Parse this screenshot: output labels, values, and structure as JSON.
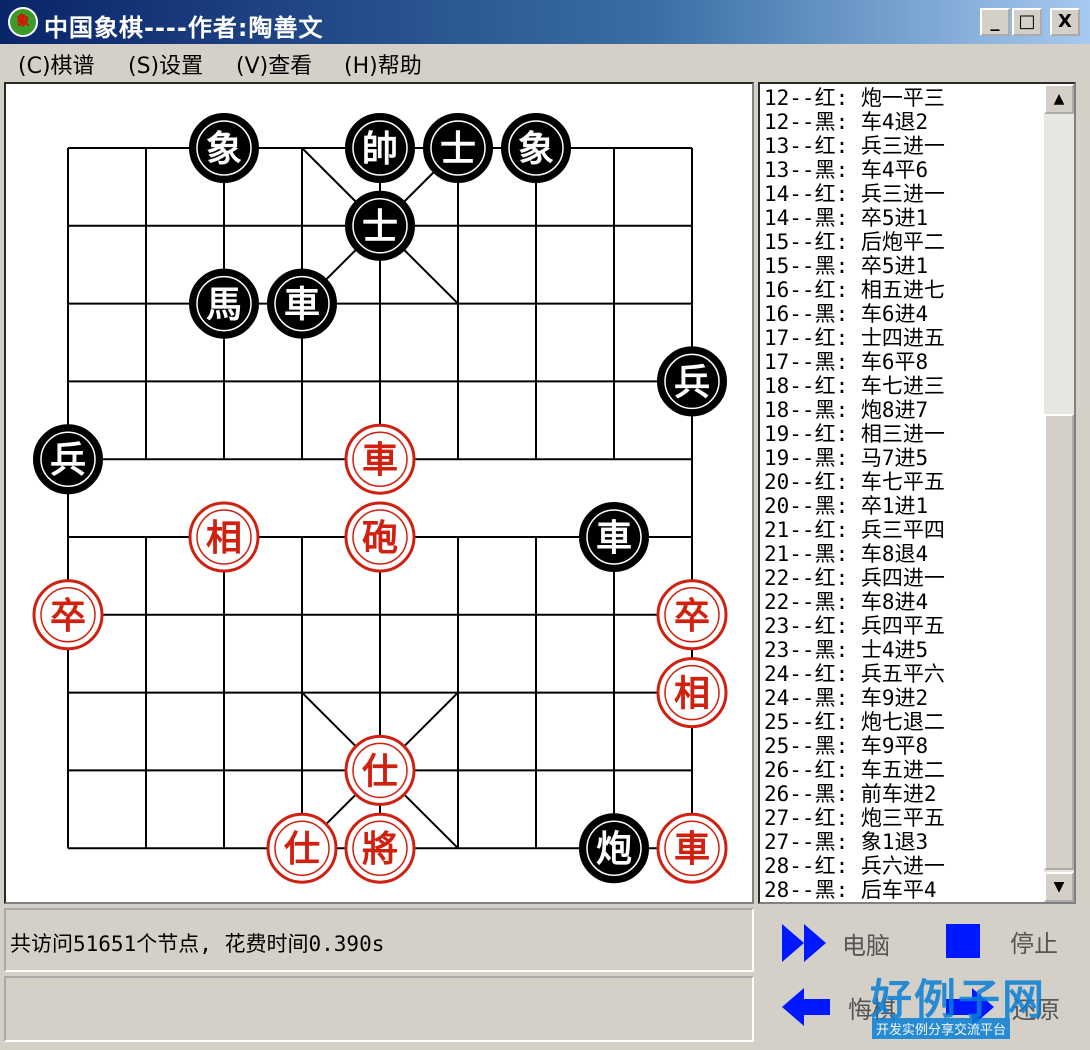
{
  "window": {
    "title": "中国象棋----作者:陶善文",
    "app_icon_text": "象",
    "controls": {
      "minimize": "_",
      "maximize": "□",
      "close": "X"
    }
  },
  "menu": [
    {
      "label": "(C)棋谱"
    },
    {
      "label": "(S)设置"
    },
    {
      "label": "(V)查看"
    },
    {
      "label": "(H)帮助"
    }
  ],
  "board": {
    "files": 9,
    "ranks": 10,
    "pieces": [
      {
        "color": "black",
        "char": "象",
        "file": 2,
        "rank": 0
      },
      {
        "color": "black",
        "char": "帥",
        "file": 4,
        "rank": 0
      },
      {
        "color": "black",
        "char": "士",
        "file": 5,
        "rank": 0
      },
      {
        "color": "black",
        "char": "象",
        "file": 6,
        "rank": 0
      },
      {
        "color": "black",
        "char": "士",
        "file": 4,
        "rank": 1
      },
      {
        "color": "black",
        "char": "馬",
        "file": 2,
        "rank": 2
      },
      {
        "color": "black",
        "char": "車",
        "file": 3,
        "rank": 2
      },
      {
        "color": "black",
        "char": "兵",
        "file": 8,
        "rank": 3
      },
      {
        "color": "black",
        "char": "兵",
        "file": 0,
        "rank": 4
      },
      {
        "color": "red",
        "char": "車",
        "file": 4,
        "rank": 4
      },
      {
        "color": "red",
        "char": "相",
        "file": 2,
        "rank": 5
      },
      {
        "color": "red",
        "char": "砲",
        "file": 4,
        "rank": 5
      },
      {
        "color": "black",
        "char": "車",
        "file": 7,
        "rank": 5
      },
      {
        "color": "red",
        "char": "卒",
        "file": 0,
        "rank": 6
      },
      {
        "color": "red",
        "char": "卒",
        "file": 8,
        "rank": 6
      },
      {
        "color": "red",
        "char": "相",
        "file": 8,
        "rank": 7
      },
      {
        "color": "red",
        "char": "仕",
        "file": 4,
        "rank": 8
      },
      {
        "color": "red",
        "char": "仕",
        "file": 3,
        "rank": 9
      },
      {
        "color": "red",
        "char": "將",
        "file": 4,
        "rank": 9
      },
      {
        "color": "black",
        "char": "炮",
        "file": 7,
        "rank": 9
      },
      {
        "color": "red",
        "char": "車",
        "file": 8,
        "rank": 9
      }
    ]
  },
  "moves": [
    "12--红: 炮一平三",
    "12--黑: 车4退2",
    "13--红: 兵三进一",
    "13--黑: 车4平6",
    "14--红: 兵三进一",
    "14--黑: 卒5进1",
    "15--红: 后炮平二",
    "15--黑: 卒5进1",
    "16--红: 相五进七",
    "16--黑: 车6进4",
    "17--红: 士四进五",
    "17--黑: 车6平8",
    "18--红: 车七进三",
    "18--黑: 炮8进7",
    "19--红: 相三进一",
    "19--黑: 马7进5",
    "20--红: 车七平五",
    "20--黑: 卒1进1",
    "21--红: 兵三平四",
    "21--黑: 车8退4",
    "22--红: 兵四进一",
    "22--黑: 车8进4",
    "23--红: 兵四平五",
    "23--黑: 士4进5",
    "24--红: 兵五平六",
    "24--黑: 车9进2",
    "25--红: 炮七退二",
    "25--黑: 车9平8",
    "26--红: 车五进二",
    "26--黑: 前车进2",
    "27--红: 炮三平五",
    "27--黑: 象1退3",
    "28--红: 兵六进一",
    "28--黑: 后车平4"
  ],
  "status": {
    "message": "共访问51651个节点, 花费时间0.390s"
  },
  "controls": {
    "computer_label": "电脑",
    "stop_label": "停止",
    "undo_label": "悔棋",
    "redo_label": "还原"
  },
  "watermark": {
    "logo_text": "好例子网",
    "logo_subtext": "开发实例分享交流平台"
  },
  "colors": {
    "red_piece": "#d02010",
    "black_piece": "#000000",
    "button_blue": "#0018ff",
    "titlebar": "#0a246a"
  }
}
